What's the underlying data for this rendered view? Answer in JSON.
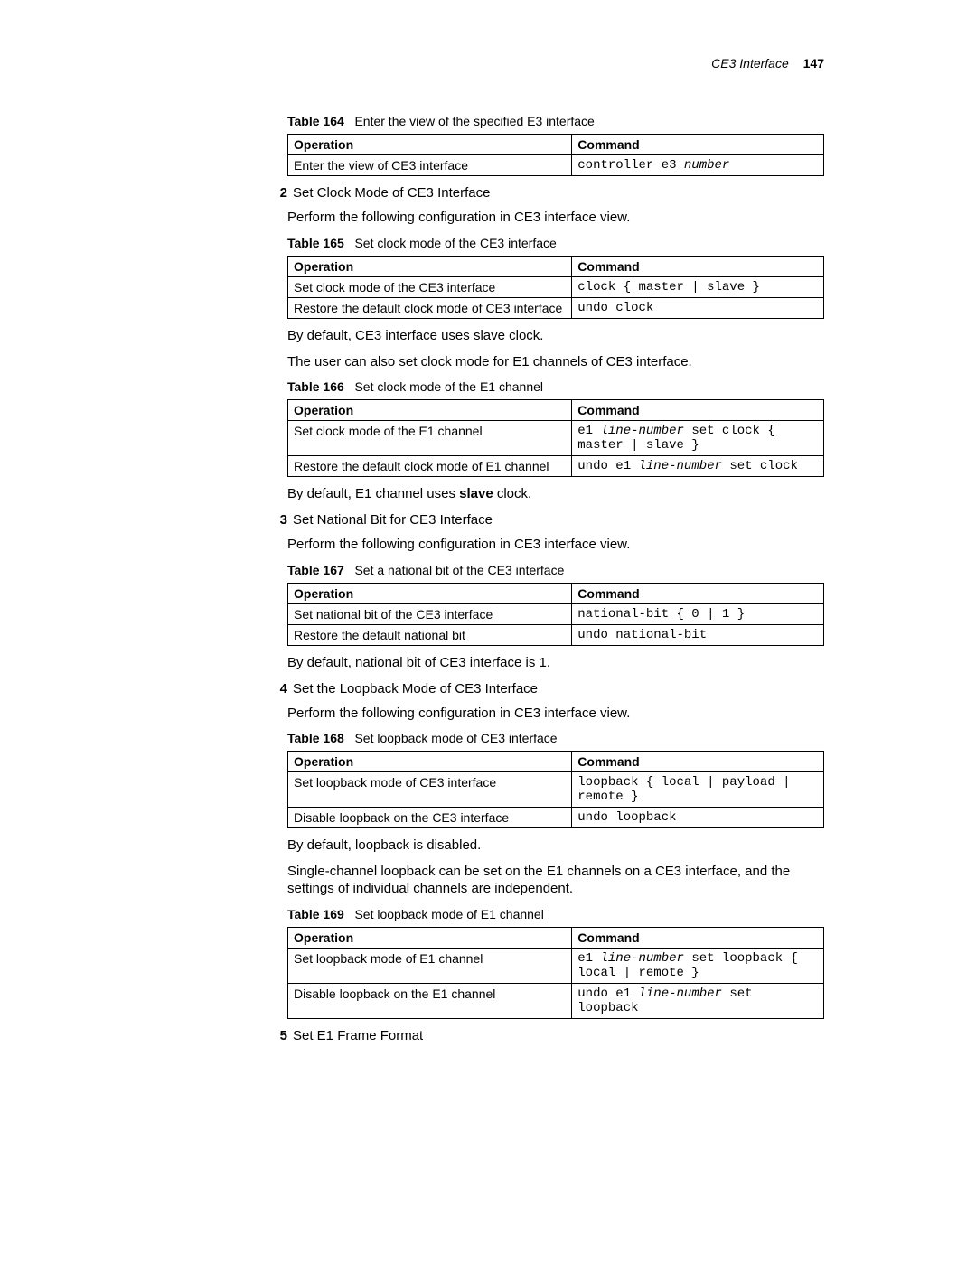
{
  "header": {
    "section": "CE3 Interface",
    "page": "147"
  },
  "t164": {
    "caption_label": "Table 164",
    "caption_text": "Enter the view of the specified E3 interface",
    "h1": "Operation",
    "h2": "Command",
    "r1c1": "Enter the view of CE3 interface",
    "r1c2a": "controller e3 ",
    "r1c2b": "number"
  },
  "s2": {
    "num": "2",
    "title": "Set Clock Mode of CE3 Interface",
    "p1": "Perform the following configuration in CE3 interface view."
  },
  "t165": {
    "caption_label": "Table 165",
    "caption_text": "Set clock mode of the CE3 interface",
    "h1": "Operation",
    "h2": "Command",
    "r1c1": "Set clock mode of the CE3 interface",
    "r1c2": "clock { master | slave }",
    "r2c1": "Restore the default clock mode of CE3 interface",
    "r2c2": "undo clock"
  },
  "s2b": {
    "p2": "By default, CE3 interface uses slave clock.",
    "p3": "The user can also set clock mode for E1 channels of CE3 interface."
  },
  "t166": {
    "caption_label": "Table 166",
    "caption_text": "Set clock mode of the E1 channel",
    "h1": "Operation",
    "h2": "Command",
    "r1c1": "Set clock mode of the E1 channel",
    "r1c2_a": "e1 ",
    "r1c2_b": "line-number",
    "r1c2_c": " set clock { master | slave }",
    "r2c1": "Restore the default clock mode of E1 channel",
    "r2c2_a": "undo e1 ",
    "r2c2_b": "line-number",
    "r2c2_c": " set clock"
  },
  "s2c": {
    "p4a": "By default, E1 channel uses ",
    "p4b": "slave",
    "p4c": " clock."
  },
  "s3": {
    "num": "3",
    "title": "Set National Bit for CE3 Interface",
    "p1": "Perform the following configuration in CE3 interface view."
  },
  "t167": {
    "caption_label": "Table 167",
    "caption_text": "Set a national bit of the CE3 interface",
    "h1": "Operation",
    "h2": "Command",
    "r1c1": "Set national bit of the CE3 interface",
    "r1c2": "national-bit { 0 | 1 }",
    "r2c1": "Restore the default national bit",
    "r2c2": "undo national-bit"
  },
  "s3b": {
    "p2": "By default, national bit of CE3 interface is 1."
  },
  "s4": {
    "num": "4",
    "title": "Set the Loopback Mode of CE3 Interface",
    "p1": "Perform the following configuration in CE3 interface view."
  },
  "t168": {
    "caption_label": "Table 168",
    "caption_text": "Set loopback mode of CE3 interface",
    "h1": "Operation",
    "h2": "Command",
    "r1c1": "Set loopback mode of CE3 interface",
    "r1c2": "loopback { local | payload | remote }",
    "r2c1": "Disable loopback on the CE3 interface",
    "r2c2": "undo loopback"
  },
  "s4b": {
    "p2": "By default, loopback is disabled.",
    "p3": "Single-channel loopback can be set on the E1 channels on a CE3 interface, and the settings of individual channels are independent."
  },
  "t169": {
    "caption_label": "Table 169",
    "caption_text": "Set loopback mode of E1 channel",
    "h1": "Operation",
    "h2": "Command",
    "r1c1": "Set loopback mode of E1 channel",
    "r1c2_a": "e1 ",
    "r1c2_b": "line-number",
    "r1c2_c": " set loopback { local | remote }",
    "r2c1": "Disable loopback on the E1 channel",
    "r2c2_a": "undo e1 ",
    "r2c2_b": "line-number",
    "r2c2_c": " set loopback"
  },
  "s5": {
    "num": "5",
    "title": "Set E1 Frame Format"
  }
}
